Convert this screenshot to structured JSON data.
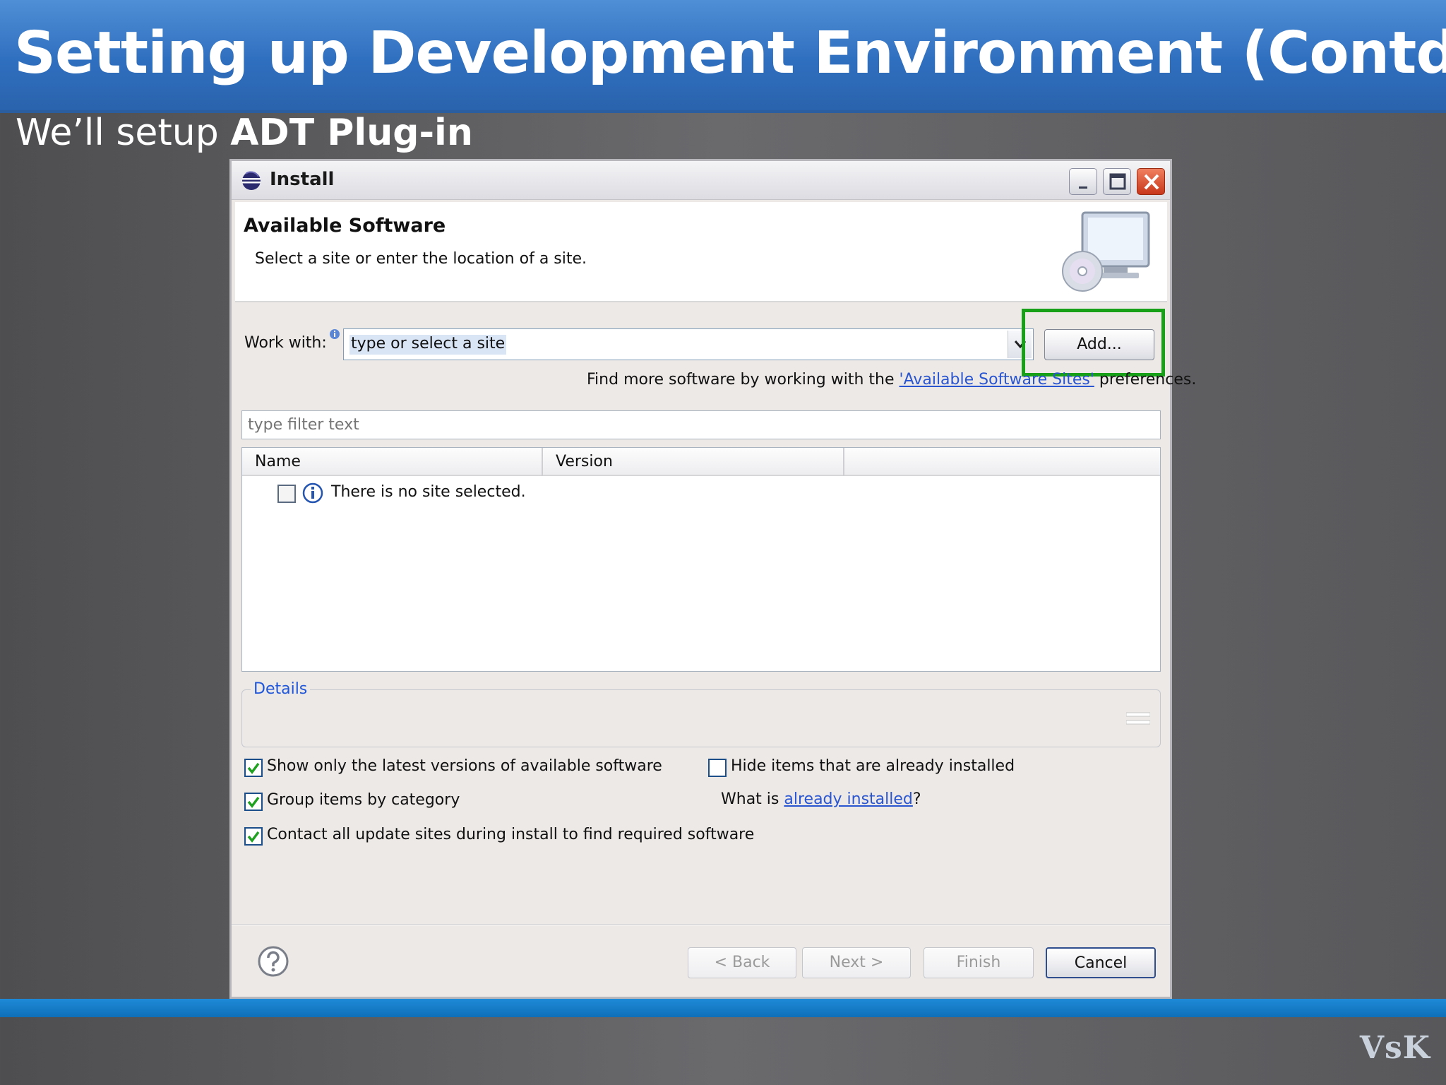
{
  "slide": {
    "title": "Setting up Development Environment (Contd.)",
    "subtitle_prefix": "We’ll setup ",
    "subtitle_bold": "ADT Plug-in",
    "footer_logo": "VsK"
  },
  "dialog": {
    "title": "Install",
    "banner_title": "Available Software",
    "banner_description": "Select a site or enter the location of a site.",
    "work_with_label": "Work with:",
    "work_with_value": "type or select a site",
    "add_button": "Add...",
    "find_more_prefix": "Find more software by working with the ",
    "find_more_link": "'Available Software Sites'",
    "find_more_suffix": " preferences.",
    "filter_placeholder": "type filter text",
    "columns": [
      "Name",
      "Version"
    ],
    "empty_message": "There is no site selected.",
    "details_label": "Details",
    "options": {
      "show_latest": "Show only the latest versions of available software",
      "group_by_category": "Group items by category",
      "contact_update_sites": "Contact all update sites during install to find required software",
      "hide_installed": "Hide items that are already installed",
      "what_installed_prefix": "What is ",
      "what_installed_link": "already installed",
      "what_installed_suffix": "?"
    },
    "buttons": {
      "back": "< Back",
      "next": "Next >",
      "finish": "Finish",
      "cancel": "Cancel"
    }
  },
  "colors": {
    "header_blue": "#2f6fbf",
    "highlight_green": "#18a018",
    "link_blue": "#2a55d0"
  }
}
